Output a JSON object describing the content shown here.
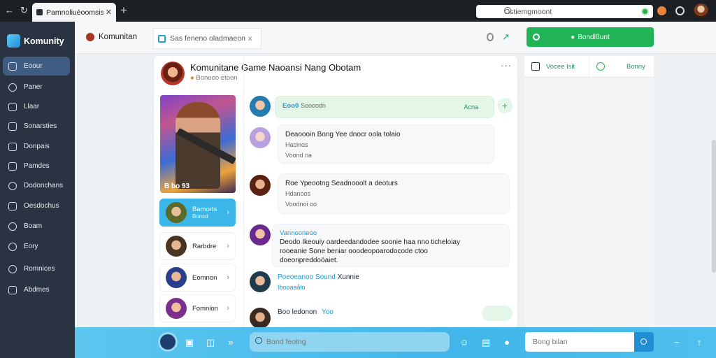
{
  "browser": {
    "tab_title": "Pamnoliuèoomsis",
    "omnibox_text": "Ostiemgmoont"
  },
  "sidebar": {
    "brand": "Komunity",
    "items": [
      {
        "label": "Eoour",
        "icon": "home-icon"
      },
      {
        "label": "Paner",
        "icon": "chat-icon"
      },
      {
        "label": "Llaar",
        "icon": "chart-icon"
      },
      {
        "label": "Sonarsties",
        "icon": "list-icon"
      },
      {
        "label": "Donpais",
        "icon": "doc-icon"
      },
      {
        "label": "Pamdes",
        "icon": "grid-icon"
      },
      {
        "label": "Dodonchans",
        "icon": "link-icon"
      },
      {
        "label": "Oesdochus",
        "icon": "box-icon"
      },
      {
        "label": "Boam",
        "icon": "circle-icon"
      },
      {
        "label": "Eory",
        "icon": "gear-icon"
      },
      {
        "label": "Romnices",
        "icon": "bell-icon"
      },
      {
        "label": "Abdmes",
        "icon": "settings-icon"
      }
    ]
  },
  "appbar": {
    "app_name": "Komunitan",
    "breadcrumb": "Sas feneno oladmaeon",
    "breadcrumb_close": "x",
    "join_label": "Bondlßunt"
  },
  "group": {
    "title": "Komunitane Game Naoansi Nang Obotam",
    "subtitle": "Bonooo etoon",
    "hero_caption": "B  bo 93"
  },
  "members": [
    {
      "name": "Bamorts",
      "sub": "Bonsd",
      "active": true
    },
    {
      "name": "Rarbdre",
      "active": false
    },
    {
      "name": "Eomnon",
      "active": false
    },
    {
      "name": "Fomnion",
      "active": false
    }
  ],
  "messages": [
    {
      "type": "green",
      "who": "Eoo0",
      "text": "Soooodn",
      "meta": "Acna"
    },
    {
      "type": "plain",
      "text": "Deaoooin Bong Yee dnocr oola tolaio",
      "line2": "Hacinos",
      "meta": "Voond na"
    },
    {
      "type": "plain",
      "text": "Roe Ypeootng Seadnooolt a deoturs",
      "line2": "Hdanoos",
      "meta": "Voodnoi oo"
    },
    {
      "type": "plain",
      "who": "Vannooneoo",
      "text": "Deodo Ikeouiy oardeedandodee soonie haa nno ticheloiay",
      "line2": "rooeanie Sone beniar ooodeopoarodocode ctoo",
      "line3": "doeonpreddoöaiet."
    },
    {
      "type": "inline",
      "who": "Poeoeanoo Sound",
      "text": "Xunnie",
      "meta": "Ibooaaålo"
    },
    {
      "type": "inline",
      "text": "Boo ledonon",
      "meta": "Yoo"
    }
  ],
  "composer": {
    "message_placeholder": "Bond feotng",
    "find_placeholder": "Bong bilan"
  },
  "right_panel": {
    "tab1": "Vocee Isit",
    "tab2": "Bonny"
  },
  "colors": {
    "sidebar": "#2a3342",
    "accent": "#3ab6e9",
    "join": "#21b457"
  }
}
